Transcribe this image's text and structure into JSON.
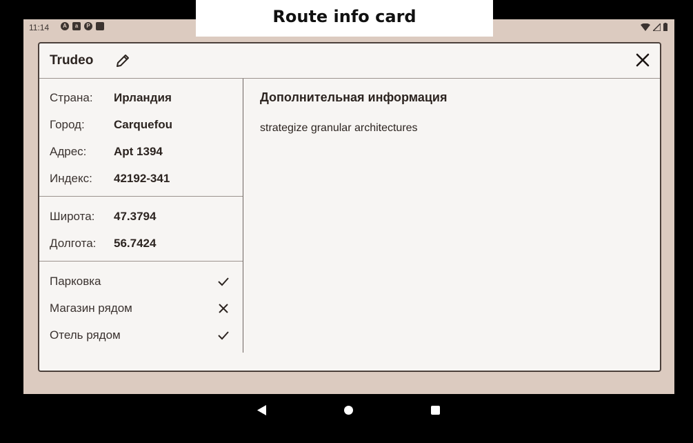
{
  "caption": "Route info card",
  "status_bar": {
    "time": "11:14"
  },
  "dialog": {
    "title": "Trudeo",
    "address": [
      {
        "label": "Страна:",
        "value": "Ирландия"
      },
      {
        "label": "Город:",
        "value": "Carquefou"
      },
      {
        "label": "Адрес:",
        "value": "Apt 1394"
      },
      {
        "label": "Индекс:",
        "value": "42192-341"
      }
    ],
    "coords": [
      {
        "label": "Широта:",
        "value": "47.3794"
      },
      {
        "label": "Долгота:",
        "value": "56.7424"
      }
    ],
    "features": [
      {
        "label": "Парковка",
        "available": true,
        "icon": "check-icon"
      },
      {
        "label": "Магазин рядом",
        "available": false,
        "icon": "cross-icon"
      },
      {
        "label": "Отель рядом",
        "available": true,
        "icon": "check-icon"
      }
    ],
    "info_title": "Дополнительная информация",
    "info_text": "strategize granular architectures"
  },
  "colors": {
    "screen_bg": "#dccbc0",
    "dialog_bg": "#f7f5f3",
    "text": "#2c2420"
  }
}
